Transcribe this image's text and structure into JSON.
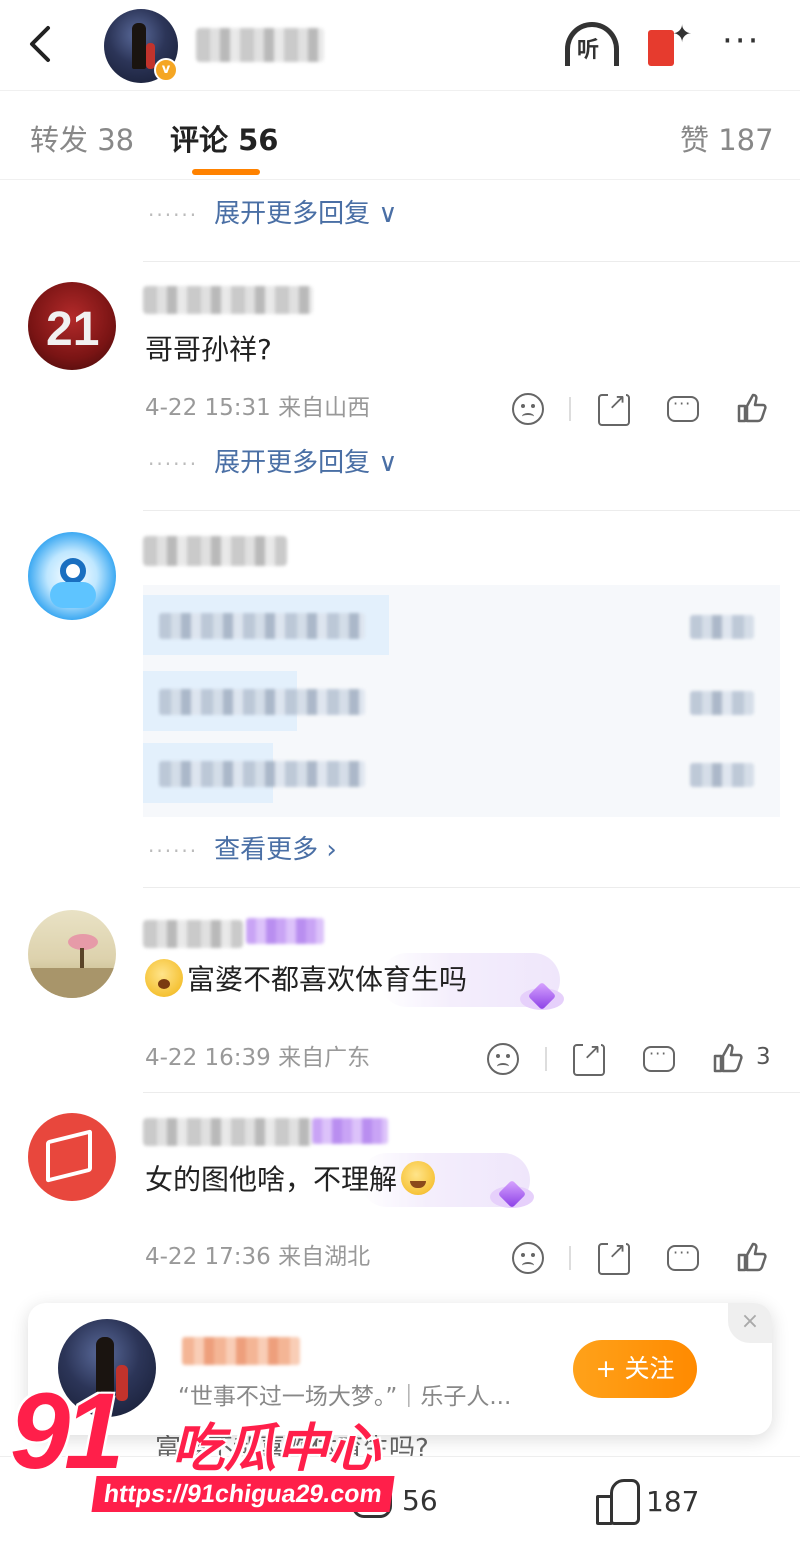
{
  "header": {
    "back_icon": "chevron-left-icon",
    "listen_label": "听",
    "more_label": "···"
  },
  "tabs": [
    {
      "label": "转发 38"
    },
    {
      "label": "评论 56"
    },
    {
      "label": "赞 187"
    }
  ],
  "expand_more_label": "展开更多回复 ∨",
  "dots": "······",
  "comments": [
    {
      "text": "哥哥孙祥?",
      "meta": "4-22 15:31  来自山西",
      "expand": "展开更多回复 ∨"
    },
    {
      "see_more": "查看更多 ›"
    },
    {
      "text": "富婆不都喜欢体育生吗",
      "meta": "4-22 16:39  来自广东",
      "likes": "3"
    },
    {
      "text": "女的图他啥，不理解",
      "meta": "4-22 17:36  来自湖北"
    }
  ],
  "follow_card": {
    "bio": "“世事不过一场大梦。”｜乐子人...",
    "follow_label": "+ 关注",
    "close_label": "×"
  },
  "bottom_bar": {
    "peek_text": "富婆不都喜欢体育生吗?",
    "comment_count": "56",
    "like_count": "187"
  },
  "watermark": {
    "number": "91",
    "name": "吃瓜中心",
    "url": "https://91chigua29.com"
  },
  "colors": {
    "accent": "#ff8200",
    "link": "#4a6fa5",
    "watermark": "#ff1f4a"
  }
}
